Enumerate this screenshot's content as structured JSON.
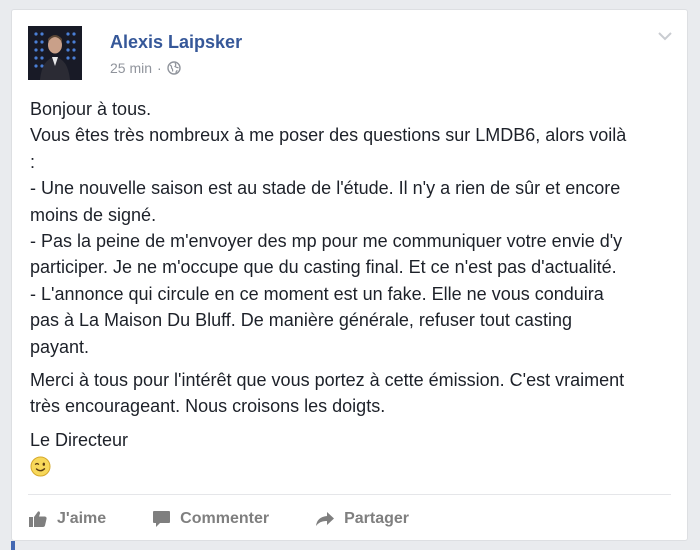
{
  "post": {
    "author": "Alexis Laipsker",
    "time": "25 min",
    "separator": "·",
    "privacy_icon": "globe-icon",
    "menu_icon": "chevron-down-icon",
    "paragraphs": [
      [
        "Bonjour à tous.",
        "Vous êtes très nombreux à me poser des questions sur LMDB6, alors voilà",
        ":",
        "- Une nouvelle saison est au stade de l'étude. Il n'y a rien de sûr et encore",
        "moins de signé.",
        "- Pas la peine de m'envoyer des mp pour me communiquer votre envie d'y",
        "participer. Je ne m'occupe que du casting final. Et ce n'est pas d'actualité.",
        "- L'annonce qui circule en ce moment est un fake. Elle ne vous conduira",
        "pas à La Maison Du Bluff. De manière générale, refuser tout casting",
        "payant."
      ],
      [
        "Merci à tous pour l'intérêt que vous portez à cette émission. C'est vraiment",
        "très encourageant. Nous croisons les doigts."
      ],
      [
        "Le Directeur"
      ]
    ],
    "emoji": "wink-emoji-icon"
  },
  "actions": {
    "like": {
      "label": "J'aime",
      "icon": "thumbs-up-icon"
    },
    "comment": {
      "label": "Commenter",
      "icon": "comment-icon"
    },
    "share": {
      "label": "Partager",
      "icon": "share-arrow-icon"
    }
  },
  "colors": {
    "author": "#365899",
    "meta": "#90949c",
    "text": "#1d2129",
    "action": "#7f7f7f",
    "accent": "#4267b2"
  }
}
